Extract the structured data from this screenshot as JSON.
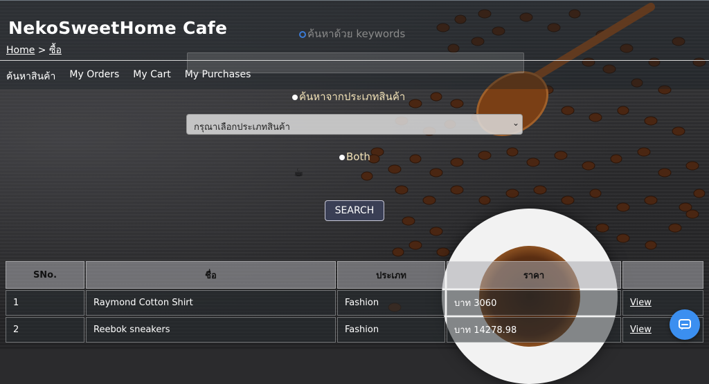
{
  "brand": "NekoSweetHome Cafe",
  "breadcrumb": {
    "home": "Home",
    "separator": ">",
    "current": "ซื้อ"
  },
  "nav": [
    "ค้นหาสินค้า",
    "My Orders",
    "My Cart",
    "My Purchases"
  ],
  "search": {
    "keyword_label": "ค้นหาด้วย keywords",
    "keyword_value": "",
    "category_label": "ค้นหาจากประเภทสินค้า",
    "category_select": "กรุณาเลือกประเภทสินค้า",
    "both_label": "Both",
    "button": "SEARCH"
  },
  "table": {
    "headers": [
      "SNo.",
      "ชื่อ",
      "ประเภท",
      "ราคา",
      ""
    ],
    "rows": [
      [
        "1",
        "Raymond Cotton Shirt",
        "Fashion",
        "บาท 3060",
        "View"
      ],
      [
        "2",
        "Reebok sneakers",
        "Fashion",
        "บาท 14278.98",
        "View"
      ]
    ]
  },
  "icons": {
    "coffee": "coffee-cup-icon",
    "chat": "chat-icon"
  },
  "colors": {
    "accent": "#3b8ff0",
    "button_bg": "#3a3f55",
    "label_gold": "#f3e3b8"
  }
}
